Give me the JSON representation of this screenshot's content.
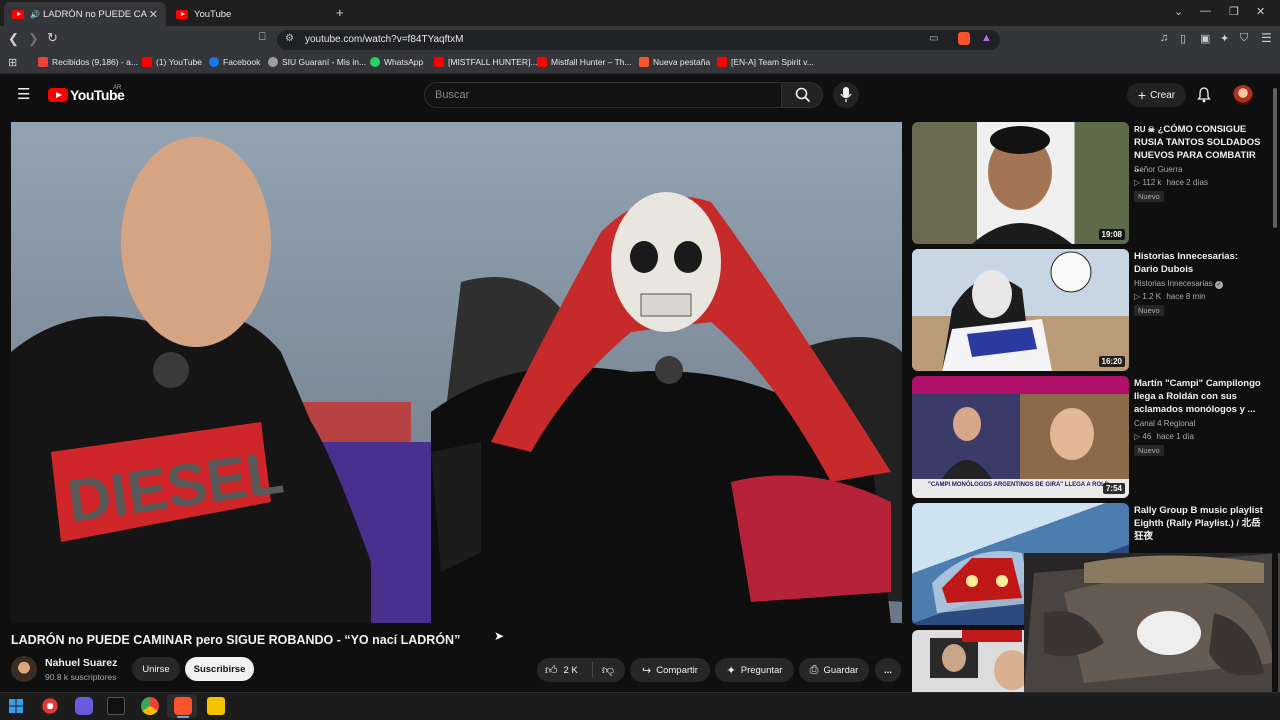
{
  "browser": {
    "tabs": [
      {
        "label": "LADRÓN no PUEDE CAMINAR pero SIGUE ROBANDO - “YO nací LADRÓN”",
        "active": true
      },
      {
        "label": "YouTube",
        "active": false
      }
    ],
    "url": "youtube.com/watch?v=f84TYaqftxM",
    "bookmarks": [
      {
        "label": "Recibidos (9,186) - a...",
        "icon": "gmail-icon"
      },
      {
        "label": "(1) YouTube",
        "icon": "youtube-icon"
      },
      {
        "label": "Facebook",
        "icon": "facebook-icon"
      },
      {
        "label": "SIU Guaraní - Mis in...",
        "icon": "siu-icon"
      },
      {
        "label": "WhatsApp",
        "icon": "whatsapp-icon"
      },
      {
        "label": "[MISTFALL HUNTER]...",
        "icon": "youtube-icon"
      },
      {
        "label": "Mistfall Hunter – Th...",
        "icon": "youtube-icon"
      },
      {
        "label": "Nueva pestaña",
        "icon": "brave-icon"
      },
      {
        "label": "[EN-A] Team Spirit v...",
        "icon": "youtube-icon"
      }
    ]
  },
  "youtube": {
    "logo_text": "YouTube",
    "country_code": "AR",
    "search_placeholder": "Buscar",
    "create_label": "Crear"
  },
  "video": {
    "title": "LADRÓN no PUEDE CAMINAR pero SIGUE ROBANDO - “YO nací LADRÓN”",
    "channel": "Nahuel Suarez",
    "subscribers": "90.8 k suscriptores",
    "join_label": "Unirse",
    "subscribe_label": "Suscribirse",
    "likes": "2 K",
    "share_label": "Compartir",
    "ask_label": "Preguntar",
    "save_label": "Guardar",
    "more_label": "..."
  },
  "recommendations": [
    {
      "prefix": "RU ☠",
      "title": "¿CÓMO CONSIGUE RUSIA TANTOS SOLDADOS NUEVOS PARA COMBATIR ...",
      "channel": "Señor Guerra",
      "views": "112 k",
      "age": "hace 2 días",
      "badge": "Nuevo",
      "duration": "19:08",
      "verified": false
    },
    {
      "prefix": "",
      "title": "Historias Innecesarias: Dario Dubois",
      "channel": "Historias Innecesarias",
      "views": "1.2 K",
      "age": "hace 8 min",
      "badge": "Nuevo",
      "duration": "16:20",
      "verified": true
    },
    {
      "prefix": "",
      "title": "Martín \"Campi\" Campilongo llega a Roldán con sus aclamados monólogos y ...",
      "channel": "Canal 4 Regional",
      "views": "46",
      "age": "hace 1 día",
      "badge": "Nuevo",
      "duration": "7:54",
      "verified": false,
      "banner": "\"CAMPI MONÓLOGOS ARGENTINOS DE GIRA\" LLEGA A ROLD"
    },
    {
      "prefix": "",
      "title": "Rally Group B music playlist Eighth (Rally Playlist.) / 北岳狂夜",
      "channel": "",
      "views": "",
      "age": "",
      "badge": "",
      "duration": "",
      "verified": false
    }
  ],
  "colors": {
    "background": "#0f0f0f",
    "youtube_red": "#ff0000",
    "pill": "#272727"
  }
}
